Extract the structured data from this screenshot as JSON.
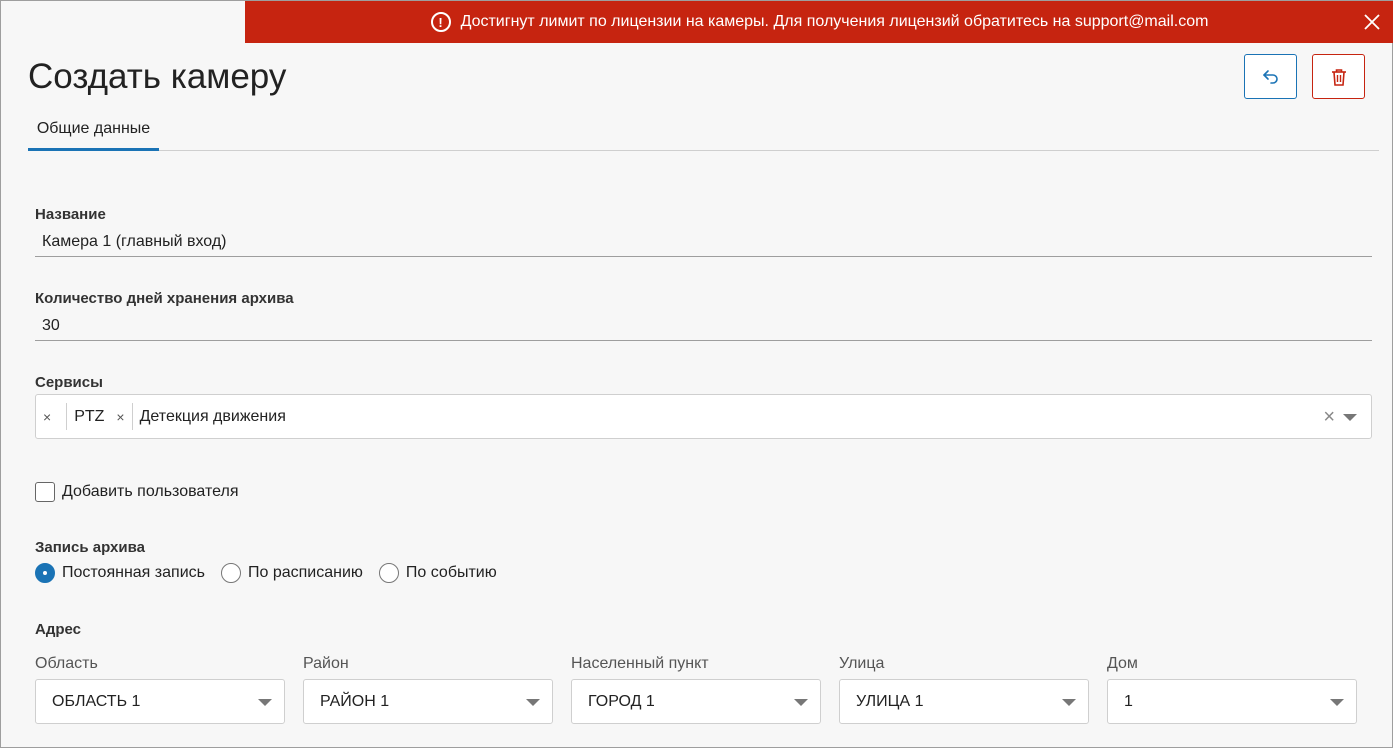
{
  "banner": {
    "message": "Достигнут лимит по лицензии на камеры. Для получения лицензий обратитесь на support@mail.com",
    "warning_icon": "!",
    "close_icon": "close-icon",
    "color": "#c62410"
  },
  "header": {
    "title": "Создать камеру",
    "undo_icon": "undo-icon",
    "delete_icon": "trash-icon"
  },
  "tabs": [
    {
      "label": "Общие данные",
      "active": true
    }
  ],
  "form": {
    "name": {
      "label": "Название",
      "value": "Камера 1 (главный вход)"
    },
    "archive_days": {
      "label": "Количество дней хранения архива",
      "value": "30"
    },
    "services": {
      "label": "Сервисы",
      "chips": [
        {
          "remove": "×",
          "label": "PTZ"
        },
        {
          "remove": "×",
          "label": "Детекция движения"
        }
      ],
      "clear": "×"
    },
    "add_user": {
      "label": "Добавить пользователя",
      "checked": false
    },
    "archive_recording": {
      "label": "Запись архива",
      "options": [
        {
          "label": "Постоянная запись",
          "checked": true
        },
        {
          "label": "По расписанию",
          "checked": false
        },
        {
          "label": "По событию",
          "checked": false
        }
      ]
    },
    "address": {
      "label": "Адрес",
      "fields": [
        {
          "label": "Область",
          "value": "ОБЛАСТЬ 1"
        },
        {
          "label": "Район",
          "value": "РАЙОН 1"
        },
        {
          "label": "Населенный пункт",
          "value": "ГОРОД 1"
        },
        {
          "label": "Улица",
          "value": "УЛИЦА 1"
        },
        {
          "label": "Дом",
          "value": "1"
        }
      ]
    }
  },
  "colors": {
    "accent": "#1a73b5",
    "danger": "#c62410"
  }
}
